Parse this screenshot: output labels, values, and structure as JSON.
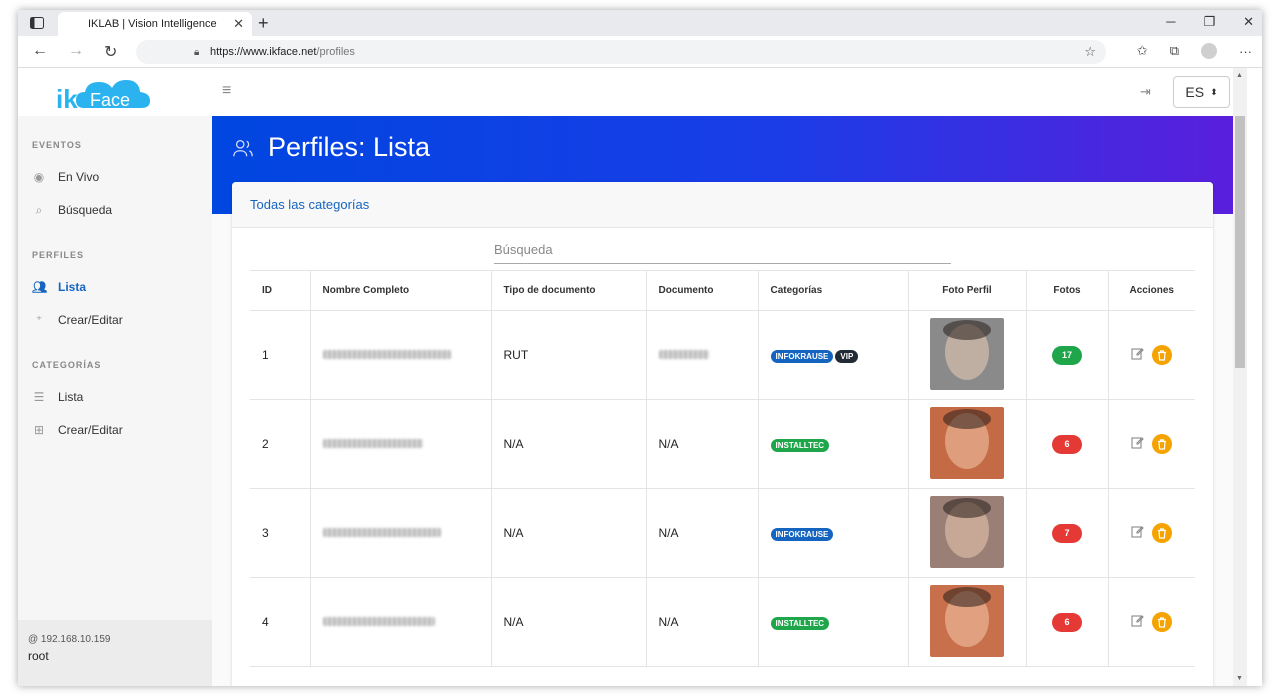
{
  "browser": {
    "tab_title": "IKLAB | Vision Intelligence",
    "tab_favicon": "K",
    "url_host": "https://www.ikface.net",
    "url_path": "/profiles"
  },
  "app": {
    "logo_prefix": "ik",
    "logo_text": "Face",
    "language": "ES"
  },
  "sidebar": {
    "sections": [
      {
        "title": "EVENTOS",
        "items": [
          {
            "label": "En Vivo",
            "icon": "eye-icon"
          },
          {
            "label": "Búsqueda",
            "icon": "search-icon"
          }
        ]
      },
      {
        "title": "PERFILES",
        "items": [
          {
            "label": "Lista",
            "icon": "users-icon",
            "active": true
          },
          {
            "label": "Crear/Editar",
            "icon": "user-plus-icon"
          }
        ]
      },
      {
        "title": "CATEGORÍAS",
        "items": [
          {
            "label": "Lista",
            "icon": "list-icon"
          },
          {
            "label": "Crear/Editar",
            "icon": "plus-square-icon"
          }
        ]
      }
    ],
    "footer": {
      "host": "@ 192.168.10.159",
      "user": "root"
    }
  },
  "main": {
    "page_title": "Perfiles: Lista",
    "card_header": "Todas las categorías",
    "search_placeholder": "Búsqueda",
    "table": {
      "headers": [
        "ID",
        "Nombre Completo",
        "Tipo de documento",
        "Documento",
        "Categorías",
        "Foto Perfil",
        "Fotos",
        "Acciones"
      ],
      "rows": [
        {
          "id": "1",
          "tipo": "RUT",
          "documento": "",
          "categorias": [
            {
              "label": "INFOKRAUSE",
              "color": "#1565c0"
            },
            {
              "label": "VIP",
              "color": "#222a35"
            }
          ],
          "fotos": "17",
          "fotos_color": "#1fa64a",
          "photo_bg": "#8a8a8a"
        },
        {
          "id": "2",
          "tipo": "N/A",
          "documento": "N/A",
          "categorias": [
            {
              "label": "INSTALLTEC",
              "color": "#1fa64a"
            }
          ],
          "fotos": "6",
          "fotos_color": "#e53935",
          "photo_bg": "#c46a45"
        },
        {
          "id": "3",
          "tipo": "N/A",
          "documento": "N/A",
          "categorias": [
            {
              "label": "INFOKRAUSE",
              "color": "#1565c0"
            }
          ],
          "fotos": "7",
          "fotos_color": "#e53935",
          "photo_bg": "#9a7f76"
        },
        {
          "id": "4",
          "tipo": "N/A",
          "documento": "N/A",
          "categorias": [
            {
              "label": "INSTALLTEC",
              "color": "#1fa64a"
            }
          ],
          "fotos": "6",
          "fotos_color": "#e53935",
          "photo_bg": "#c8704c"
        }
      ]
    }
  },
  "colors": {
    "accent": "#1565c0",
    "banner_start": "#0046e0",
    "banner_end": "#5a1fdc",
    "delete": "#f4a300"
  }
}
